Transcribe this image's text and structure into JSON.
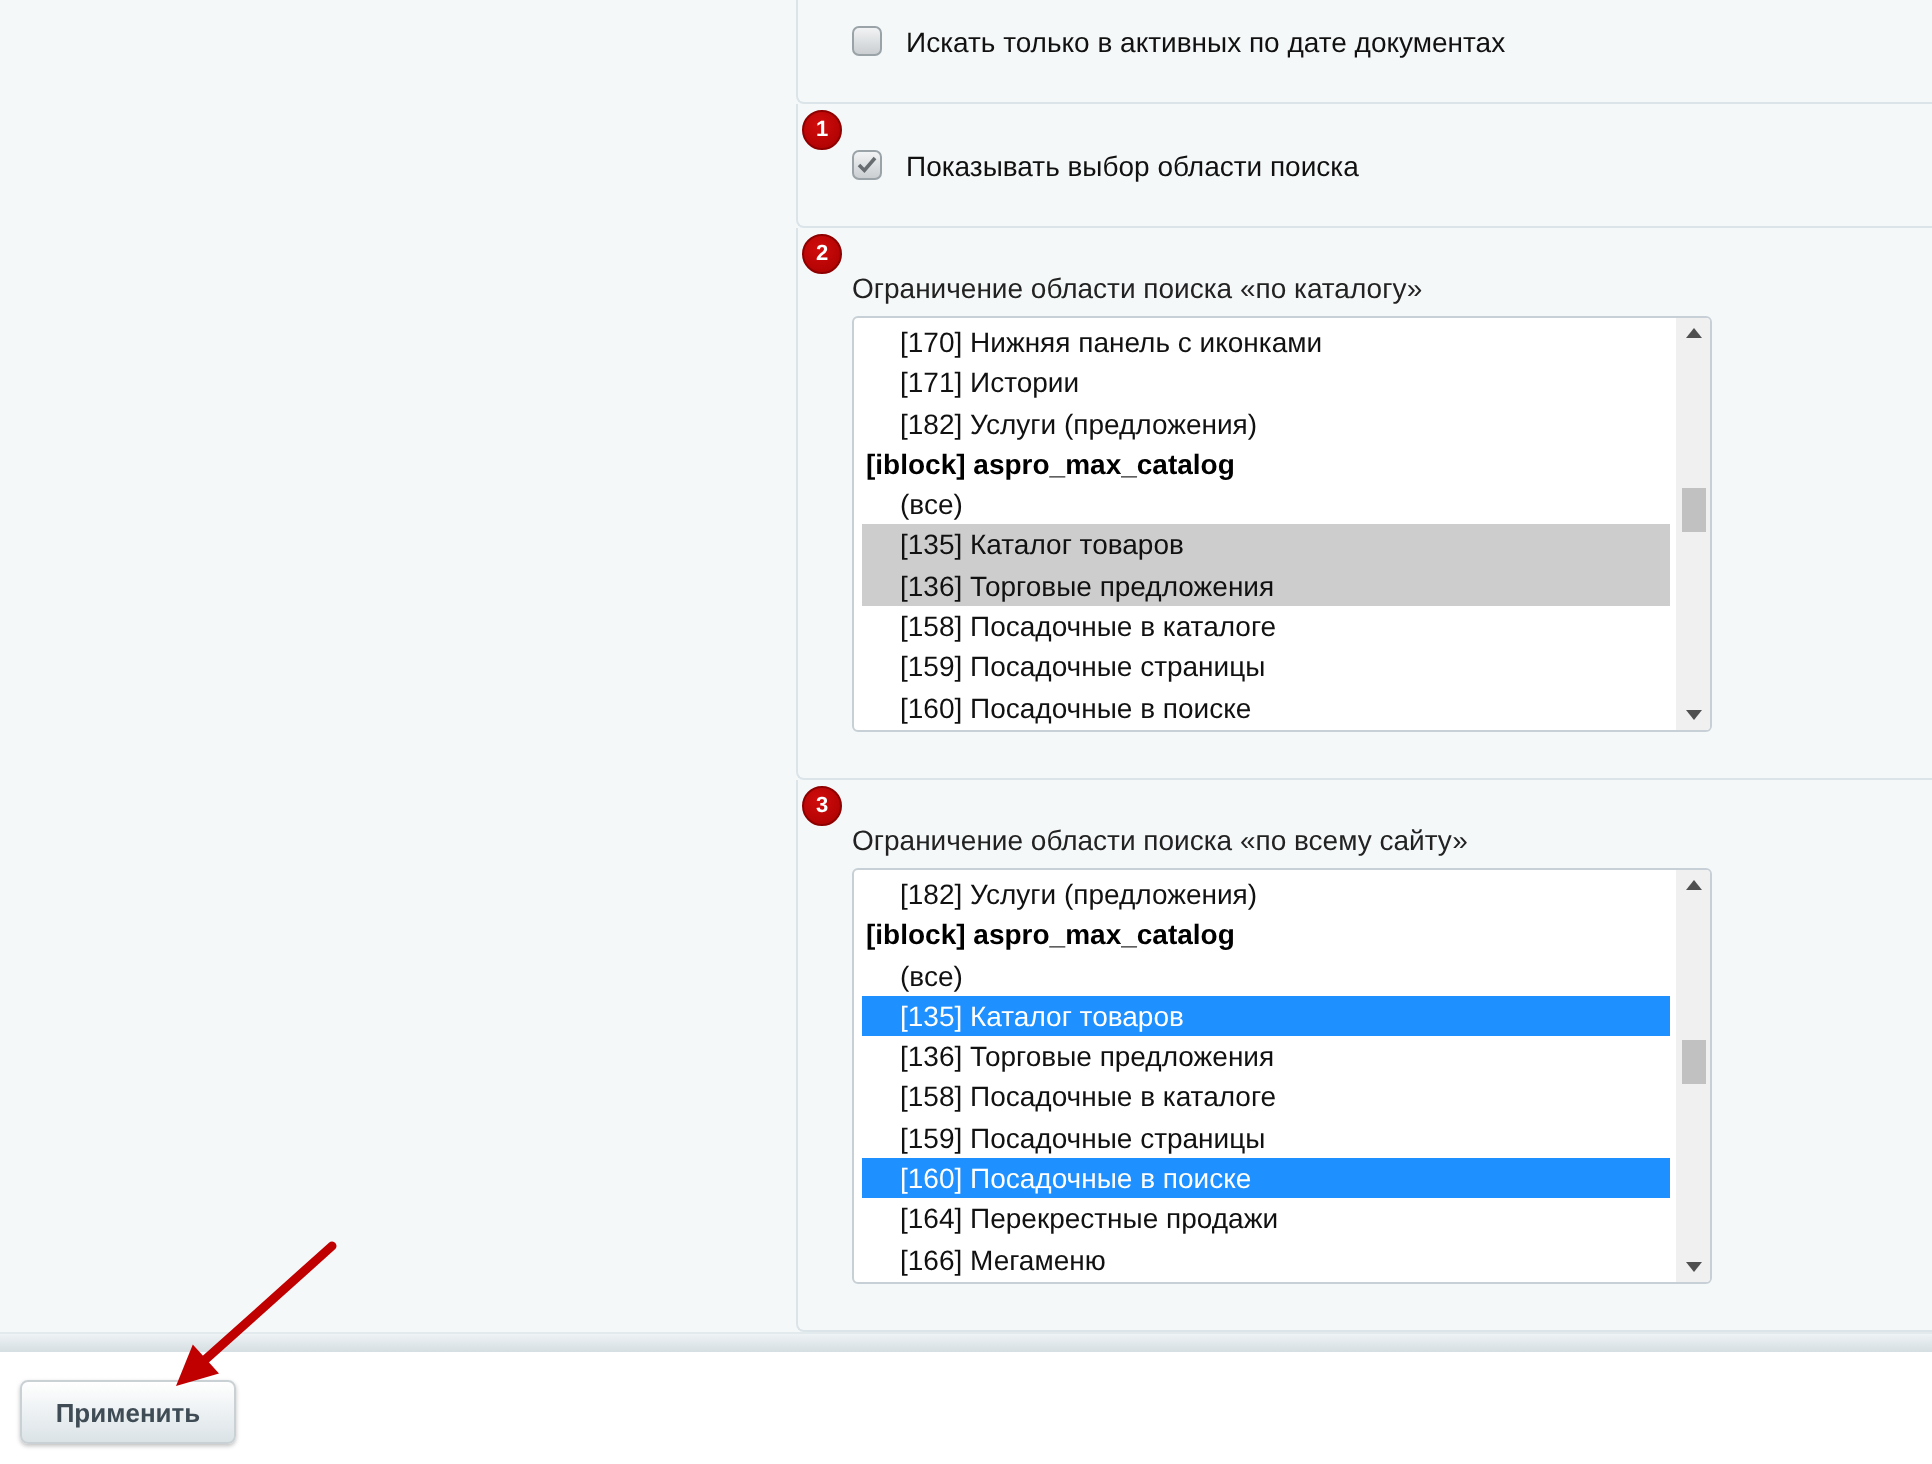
{
  "sections": [
    {
      "kind": "checkbox",
      "label": "Искать только в активных по дате документах",
      "checked": false
    },
    {
      "kind": "checkbox",
      "marker": "1",
      "label": "Показывать выбор области поиска",
      "checked": true
    },
    {
      "kind": "listbox",
      "marker": "2",
      "label": "Ограничение области поиска «по каталогу»",
      "focused": false,
      "groups": [
        {
          "children": [
            {
              "label": "[170] Нижняя панель с иконками",
              "selected": false
            },
            {
              "label": "[171] Истории",
              "selected": false
            },
            {
              "label": "[182] Услуги (предложения)",
              "selected": false
            }
          ]
        },
        {
          "label": "[iblock] aspro_max_catalog",
          "children": [
            {
              "label": "(все)",
              "selected": false
            },
            {
              "label": "[135] Каталог товаров",
              "selected": true
            },
            {
              "label": "[136] Торговые предложения",
              "selected": true
            },
            {
              "label": "[158] Посадочные в каталоге",
              "selected": false
            },
            {
              "label": "[159] Посадочные страницы",
              "selected": false
            },
            {
              "label": "[160] Посадочные в поиске",
              "selected": false
            }
          ]
        }
      ]
    },
    {
      "kind": "listbox",
      "marker": "3",
      "label": "Ограничение области поиска «по всему сайту»",
      "focused": true,
      "groups": [
        {
          "children": [
            {
              "label": "[182] Услуги (предложения)",
              "selected": false
            }
          ]
        },
        {
          "label": "[iblock] aspro_max_catalog",
          "children": [
            {
              "label": "(все)",
              "selected": false
            },
            {
              "label": "[135] Каталог товаров",
              "selected": true
            },
            {
              "label": "[136] Торговые предложения",
              "selected": false
            },
            {
              "label": "[158] Посадочные в каталоге",
              "selected": false
            },
            {
              "label": "[159] Посадочные страницы",
              "selected": false
            },
            {
              "label": "[160] Посадочные в поиске",
              "selected": true
            },
            {
              "label": "[164] Перекрестные продажи",
              "selected": false
            },
            {
              "label": "[166] Мегаменю",
              "selected": false
            }
          ]
        }
      ]
    }
  ],
  "apply_button": "Применить"
}
